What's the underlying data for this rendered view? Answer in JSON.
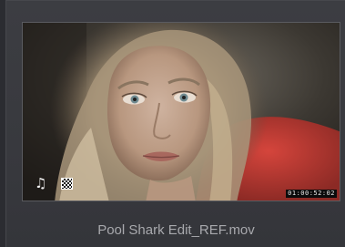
{
  "clip": {
    "name": "Pool Shark Edit_REF.mov",
    "timecode": "01:00:52:02",
    "audio_icon": "music-note-icon",
    "alpha_icon": "checkerboard-icon",
    "audio_glyph": "♫"
  },
  "colors": {
    "card_bg": "#3a3b40",
    "name_text": "#a8a9ad",
    "timecode_bg": "#0b0b0b"
  }
}
